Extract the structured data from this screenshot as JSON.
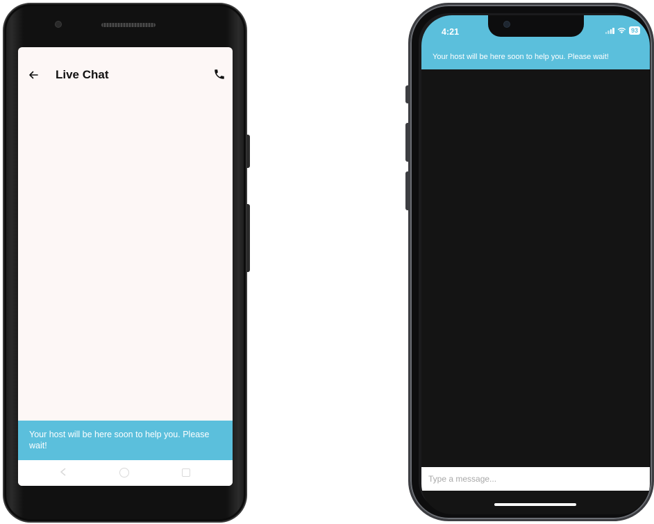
{
  "android": {
    "title": "Live Chat",
    "banner": "Your host will be here soon to help you. Please wait!",
    "icons": [
      "arrow-back-icon",
      "phone-icon",
      "nav-back-icon",
      "nav-home-icon",
      "nav-recent-icon"
    ]
  },
  "iphone": {
    "time": "4:21",
    "battery": "93",
    "banner": "Your host will be here soon to help you. Please wait!",
    "input_placeholder": "Type a message...",
    "icons": [
      "signal-icon",
      "wifi-icon",
      "battery-icon"
    ]
  },
  "colors": {
    "accent": "#5bbfdc",
    "android_bg": "#fdf7f6",
    "iphone_bg": "#141414"
  }
}
